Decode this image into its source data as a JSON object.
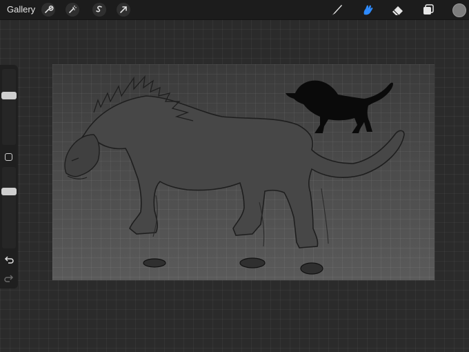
{
  "topbar": {
    "gallery_label": "Gallery",
    "left_tools": [
      "wrench-icon",
      "magic-wand-icon",
      "selection-icon",
      "transform-arrow-icon"
    ],
    "right_tools": [
      "brush-icon",
      "smudge-icon",
      "eraser-icon",
      "layers-icon"
    ],
    "active_tool": "smudge-icon",
    "active_color": "#2e8bff",
    "current_color": "#7d7d7d"
  },
  "sidebar": {
    "brush_size": 0.67,
    "brush_opacity": 0.72,
    "actions": [
      "undo-icon",
      "redo-icon"
    ]
  },
  "canvas": {
    "subject": "sketch-of-big-cat-creature",
    "background": "#4f4f4f"
  }
}
